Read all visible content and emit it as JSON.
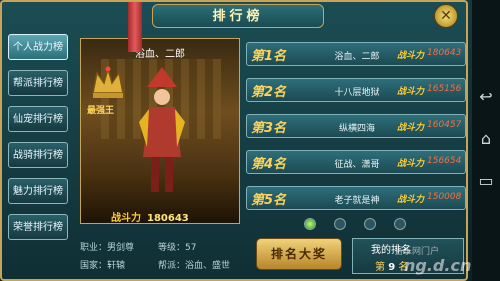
{
  "title": "排行榜",
  "sidebar": {
    "items": [
      {
        "label": "个人战力榜",
        "active": true
      },
      {
        "label": "帮派排行榜"
      },
      {
        "label": "仙宠排行榜"
      },
      {
        "label": "战骑排行榜"
      },
      {
        "label": "魅力排行榜"
      },
      {
        "label": "荣誉排行榜"
      }
    ]
  },
  "character": {
    "name": "浴血、二郎",
    "title_badge": "最强王",
    "power_label": "战斗力",
    "power_value": "180643",
    "job_label": "职业：",
    "job": "男剑尊",
    "level_label": "等级：",
    "level": "57",
    "nation_label": "国家：",
    "nation": "轩辕",
    "guild_label": "帮派：",
    "guild": "浴血、盛世"
  },
  "ranking": [
    {
      "rank": "第1名",
      "name": "浴血、二郎",
      "power_label": "战斗力",
      "power": "180643"
    },
    {
      "rank": "第2名",
      "name": "十八层地狱",
      "power_label": "战斗力",
      "power": "165156"
    },
    {
      "rank": "第3名",
      "name": "纵横四海",
      "power_label": "战斗力",
      "power": "160457"
    },
    {
      "rank": "第4名",
      "name": "征战、潇哥",
      "power_label": "战斗力",
      "power": "156654"
    },
    {
      "rank": "第5名",
      "name": "老子就是神",
      "power_label": "战斗力",
      "power": "150008"
    }
  ],
  "pages": {
    "total": 4,
    "current": 1
  },
  "buttons": {
    "reward": "排名大奖",
    "close": "✕"
  },
  "my_rank": {
    "label": "我的排名",
    "prefix": "第",
    "value": "9",
    "suffix": "名"
  },
  "watermark": {
    "line1": "当乐网门户",
    "line2": "ng.d.cn"
  },
  "icons": {
    "close": "close-icon",
    "crown": "crown-icon",
    "back": "back-icon",
    "home": "home-icon",
    "recent": "recent-apps-icon"
  }
}
